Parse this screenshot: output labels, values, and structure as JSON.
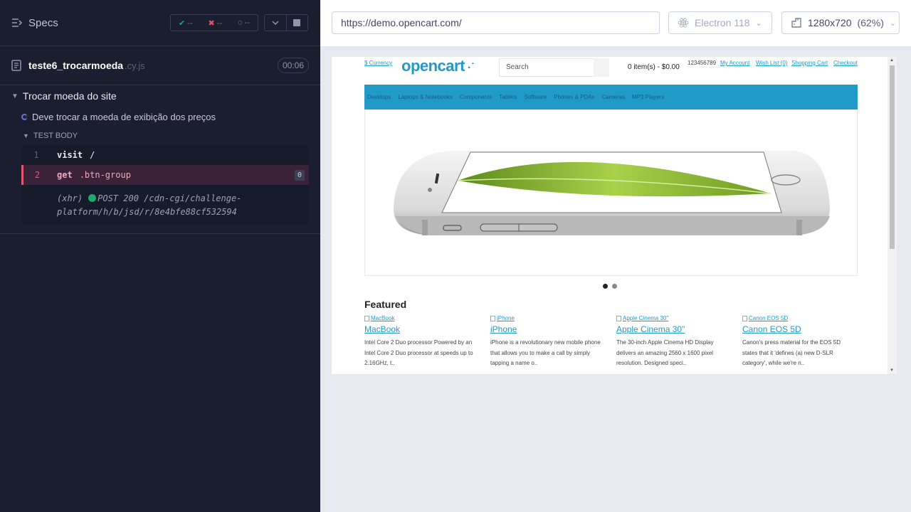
{
  "runner": {
    "specs_label": "Specs",
    "stats": {
      "passed": "--",
      "failed": "--",
      "pending": "--"
    },
    "spec_file": {
      "name": "teste6_trocarmoeda",
      "ext": ".cy.js",
      "duration": "00:06"
    },
    "suite_title": "Trocar moeda do site",
    "test_title": "Deve trocar a moeda de exibição dos preços",
    "test_body_label": "TEST BODY",
    "commands": [
      {
        "num": "1",
        "name": "visit",
        "message": "/"
      },
      {
        "num": "2",
        "name": "get",
        "message": ".btn-group",
        "count": "0"
      }
    ],
    "xhr": {
      "label": "(xhr)",
      "line1": "POST 200 /cdn-cgi/challenge-",
      "line2": "platform/h/b/jsd/r/8e4bfe88cf532594"
    }
  },
  "aut": {
    "url": "https://demo.opencart.com/",
    "browser": "Electron 118",
    "viewport": "1280x720",
    "viewport_scale": "(62%)"
  },
  "site": {
    "currency": "$ Currency",
    "logo": "opencart",
    "search_placeholder": "Search",
    "cart": "0 item(s) - $0.00",
    "phone": "123456789",
    "top_links": [
      "My Account",
      "Wish List (0)",
      "Shopping Cart",
      "Checkout"
    ],
    "menu": [
      "Desktops",
      "Laptops & Notebooks",
      "Components",
      "Tablets",
      "Software",
      "Phones & PDAs",
      "Cameras",
      "MP3 Players"
    ],
    "featured_title": "Featured",
    "products": [
      {
        "alt": "MacBook",
        "name": "MacBook",
        "desc": "Intel Core 2 Duo processor Powered by an Intel Core 2 Duo processor at speeds up to 2.16GHz, t.."
      },
      {
        "alt": "iPhone",
        "name": "iPhone",
        "desc": "iPhone is a revolutionary new mobile phone that allows you to make a call by simply tapping a name o.."
      },
      {
        "alt": "Apple Cinema 30\"",
        "name": "Apple Cinema 30\"",
        "desc": "The 30-inch Apple Cinema HD Display delivers an amazing 2560 x 1600 pixel resolution. Designed speci.."
      },
      {
        "alt": "Canon EOS 5D",
        "name": "Canon EOS 5D",
        "desc": "Canon's press material for the EOS 5D states that it 'defines (a) new D-SLR category', while we're n.."
      }
    ]
  },
  "colors": {
    "runner_bg": "#1b1e2e",
    "accent_fail": "#e45770",
    "accent_pass": "#1fa971",
    "opencart_blue": "#229ac8"
  }
}
